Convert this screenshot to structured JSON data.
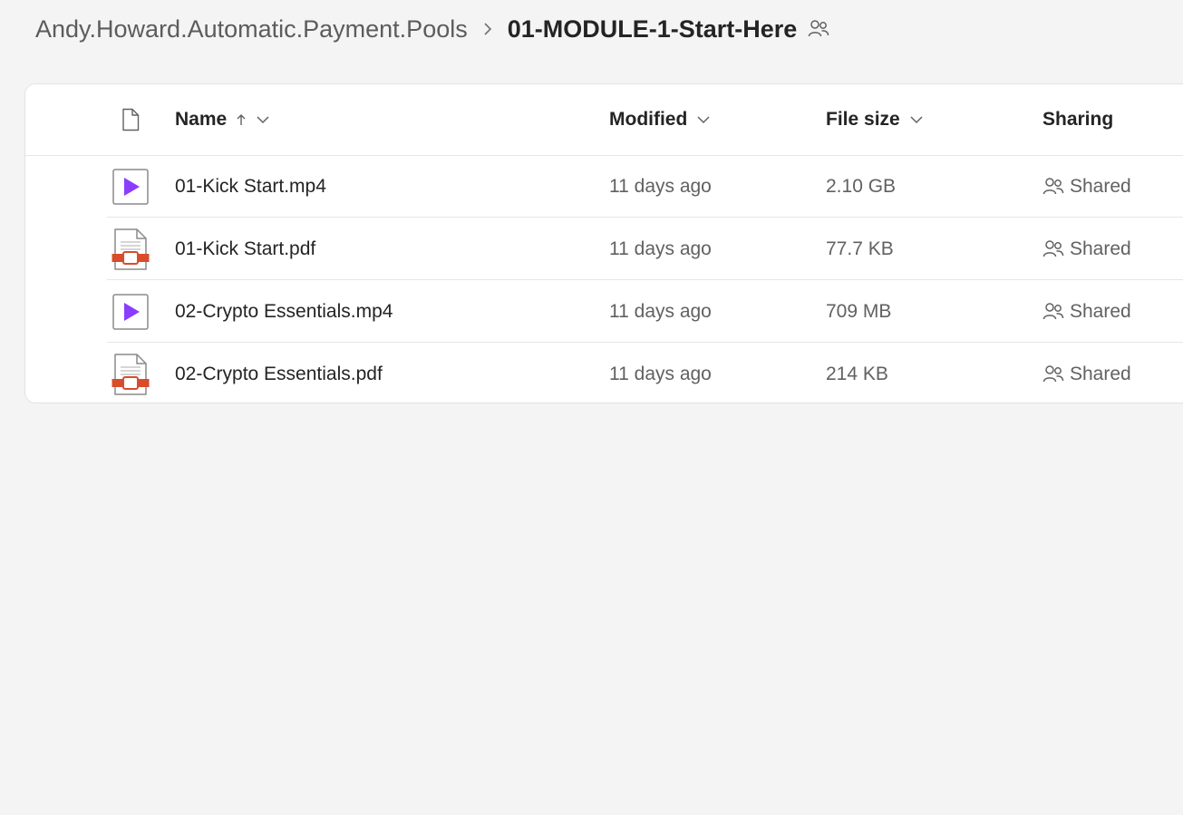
{
  "breadcrumb": {
    "parent": "Andy.Howard.Automatic.Payment.Pools",
    "separator_icon": "chevron-right-icon",
    "current": "01-MODULE-1-Start-Here",
    "shared_icon": "people-icon"
  },
  "list": {
    "columns": {
      "type_icon": "file-icon",
      "name": "Name",
      "name_sort": "ascending",
      "modified": "Modified",
      "file_size": "File size",
      "sharing": "Sharing"
    },
    "files": [
      {
        "name": "01-Kick Start.mp4",
        "type": "video",
        "icon": "video-file-icon",
        "modified": "11 days ago",
        "size": "2.10 GB",
        "sharing": "Shared"
      },
      {
        "name": "01-Kick Start.pdf",
        "type": "pdf",
        "icon": "pdf-file-icon",
        "modified": "11 days ago",
        "size": "77.7 KB",
        "sharing": "Shared"
      },
      {
        "name": "02-Crypto Essentials.mp4",
        "type": "video",
        "icon": "video-file-icon",
        "modified": "11 days ago",
        "size": "709 MB",
        "sharing": "Shared"
      },
      {
        "name": "02-Crypto Essentials.pdf",
        "type": "pdf",
        "icon": "pdf-file-icon",
        "modified": "11 days ago",
        "size": "214 KB",
        "sharing": "Shared"
      }
    ]
  },
  "colors": {
    "video_accent": "#8b3dff",
    "pdf_accent": "#d84c2b",
    "text_primary": "#242424",
    "text_secondary": "#616161",
    "page_background": "#f4f4f4"
  }
}
